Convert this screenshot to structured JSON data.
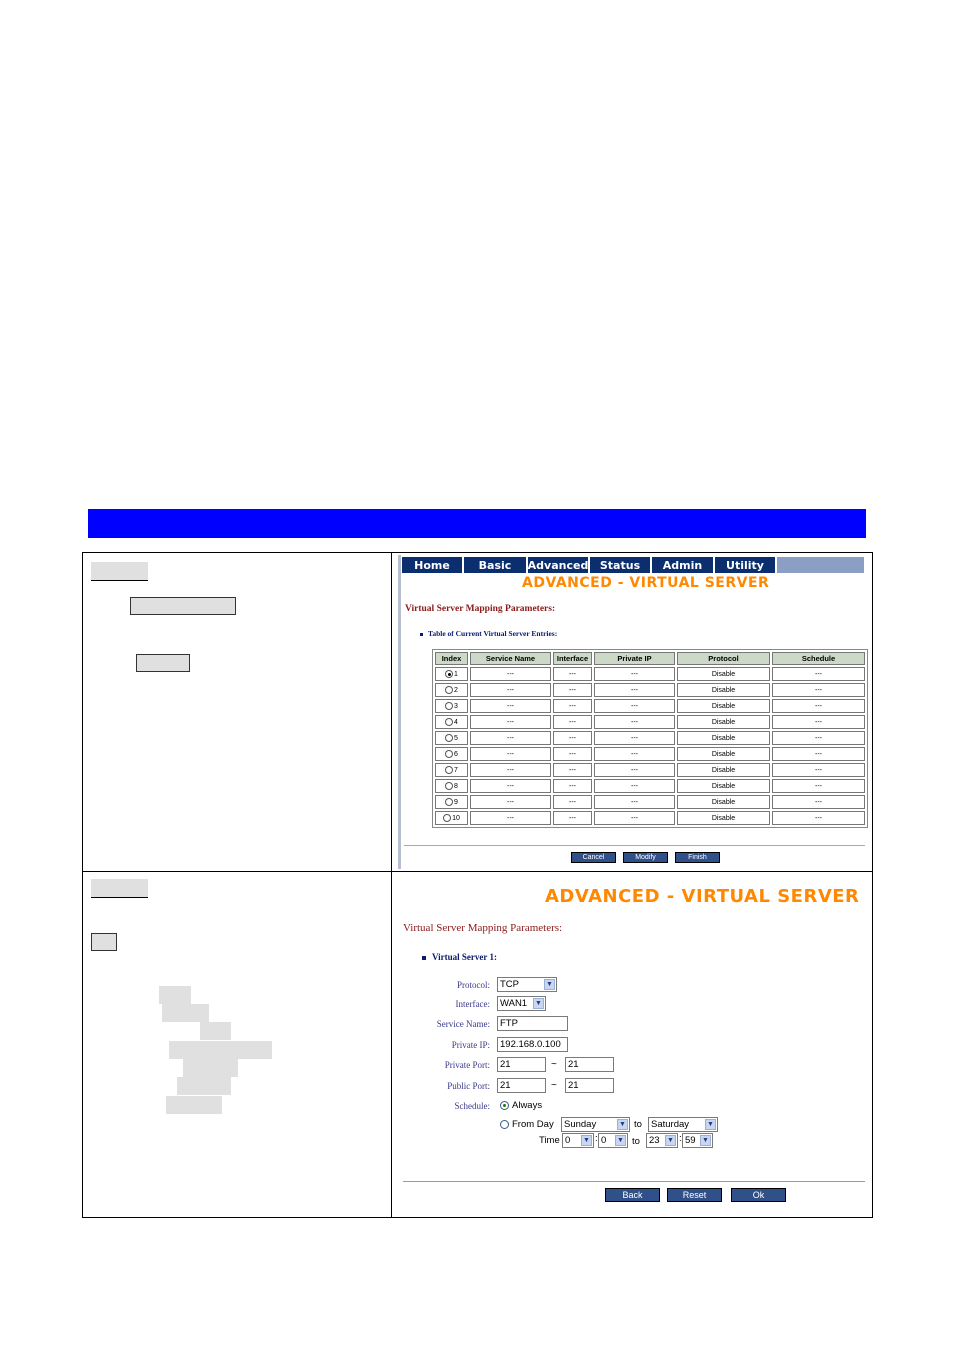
{
  "nav": [
    "Home",
    "Basic",
    "Advanced",
    "Status",
    "Admin",
    "Utility"
  ],
  "panel1": {
    "title": "ADVANCED - VIRTUAL SERVER",
    "subtitle": "Virtual Server Mapping Parameters:",
    "table_label": "Table of Current Virtual Server Entries:",
    "columns": [
      "Index",
      "Service Name",
      "Interface",
      "Private IP",
      "Protocol",
      "Schedule"
    ],
    "rows": [
      [
        "1",
        "---",
        "---",
        "---",
        "Disable",
        "---"
      ],
      [
        "2",
        "---",
        "---",
        "---",
        "Disable",
        "---"
      ],
      [
        "3",
        "---",
        "---",
        "---",
        "Disable",
        "---"
      ],
      [
        "4",
        "---",
        "---",
        "---",
        "Disable",
        "---"
      ],
      [
        "5",
        "---",
        "---",
        "---",
        "Disable",
        "---"
      ],
      [
        "6",
        "---",
        "---",
        "---",
        "Disable",
        "---"
      ],
      [
        "7",
        "---",
        "---",
        "---",
        "Disable",
        "---"
      ],
      [
        "8",
        "---",
        "---",
        "---",
        "Disable",
        "---"
      ],
      [
        "9",
        "---",
        "---",
        "---",
        "Disable",
        "---"
      ],
      [
        "10",
        "---",
        "---",
        "---",
        "Disable",
        "---"
      ]
    ],
    "buttons": {
      "cancel": "Cancel",
      "modify": "Modify",
      "finish": "Finish"
    }
  },
  "panel2": {
    "title": "ADVANCED - VIRTUAL SERVER",
    "subtitle": "Virtual Server Mapping Parameters:",
    "section_label": "Virtual Server 1:",
    "labels": {
      "protocol": "Protocol:",
      "interface": "Interface:",
      "service_name": "Service Name:",
      "private_ip": "Private IP:",
      "private_port": "Private Port:",
      "public_port": "Public Port:",
      "schedule": "Schedule:"
    },
    "values": {
      "protocol": "TCP",
      "interface": "WAN1",
      "service_name": "FTP",
      "private_ip": "192.168.0.100",
      "private_port_from": "21",
      "private_port_to": "21",
      "public_port_from": "21",
      "public_port_to": "21",
      "from_day": "Sunday",
      "to_day": "Saturday",
      "time_from_h": "0",
      "time_from_m": "0",
      "time_to_h": "23",
      "time_to_m": "59"
    },
    "tilde": "~",
    "schedule_always": "Always",
    "schedule_from_day": "From Day",
    "to_word": "to",
    "time_word": "Time",
    "colon": ":",
    "buttons": {
      "back": "Back",
      "reset": "Reset",
      "ok": "Ok"
    }
  }
}
